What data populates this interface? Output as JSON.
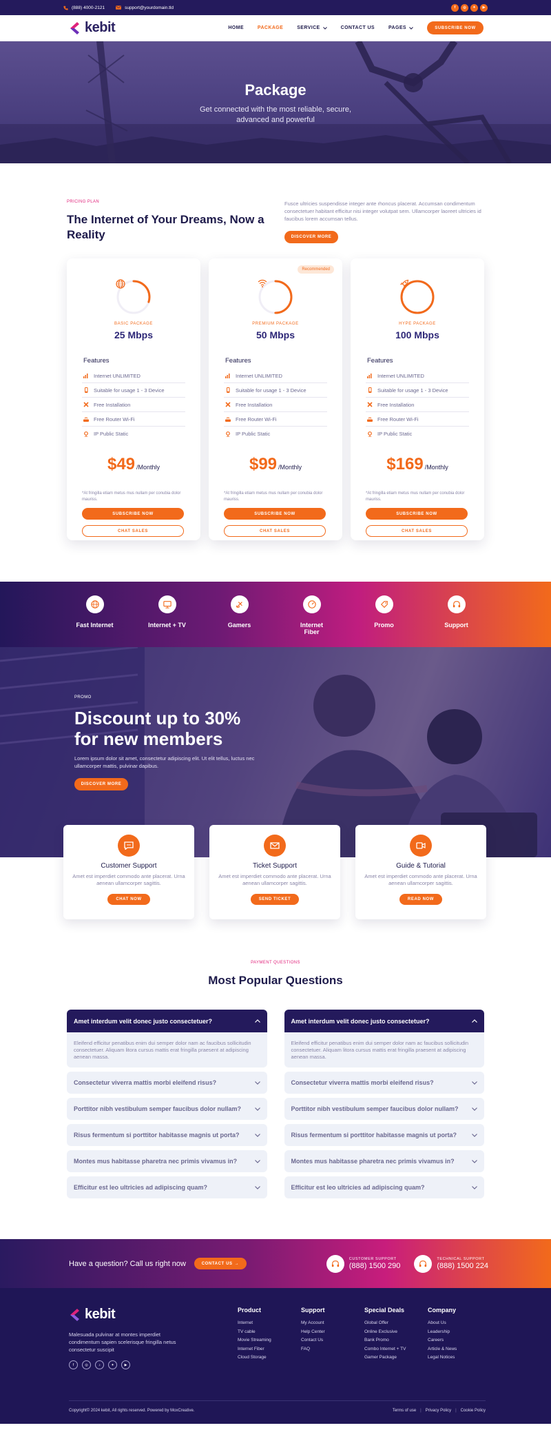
{
  "topbar": {
    "phone": "(888) 4000-2121",
    "email": "support@yourdomain.tld",
    "social": [
      "f",
      "ig",
      "tw",
      "yt"
    ]
  },
  "nav": {
    "logo": "kebit",
    "items": [
      {
        "label": "HOME"
      },
      {
        "label": "PACKAGE"
      },
      {
        "label": "SERVICE"
      },
      {
        "label": "CONTACT US"
      },
      {
        "label": "PAGES"
      }
    ],
    "cta": "SUBSCRIBE NOW"
  },
  "hero": {
    "title": "Package",
    "subtitle": "Get connected with the most reliable, secure, advanced and powerful"
  },
  "pricing": {
    "eyebrow": "PRICING PLAN",
    "title": "The Internet of Your Dreams, Now a Reality",
    "desc": "Fusce ultricies suspendisse integer ante rhoncus placerat. Accumsan condimentum consectetuer habitant efficitur nisi integer volutpat sem. Ullamcorper laoreet ultricies id faucibus lorem accumsan tellus.",
    "cta": "DISCOVER MORE"
  },
  "plans": [
    {
      "label": "BASIC PACKAGE",
      "speed": "25 Mbps",
      "progress": 0.3,
      "features_title": "Features",
      "features": [
        "Internet UNLIMITED",
        "Suitable for usage 1 - 3 Device",
        "Free Installation",
        "Free Router Wi-Fi",
        "IP Public Static"
      ],
      "price": "$49",
      "period": "/Monthly",
      "note": "*At fringilla etiam metus mus nullam per conubia dolor mauriss.",
      "subscribe": "SUBSCRIBE NOW",
      "chat": "CHAT SALES"
    },
    {
      "label": "PREMIUM PACKAGE",
      "speed": "50 Mbps",
      "progress": 0.5,
      "badge": "Recommended",
      "features_title": "Features",
      "features": [
        "Internet UNLIMITED",
        "Suitable for usage 1 - 3 Device",
        "Free Installation",
        "Free Router Wi-Fi",
        "IP Public Static"
      ],
      "price": "$99",
      "period": "/Monthly",
      "note": "*At fringilla etiam metus mus nullam per conubia dolor mauriss.",
      "subscribe": "SUBSCRIBE NOW",
      "chat": "CHAT SALES"
    },
    {
      "label": "HYPE PACKAGE",
      "speed": "100 Mbps",
      "progress": 1.0,
      "features_title": "Features",
      "features": [
        "Internet UNLIMITED",
        "Suitable for usage 1 - 3 Device",
        "Free Installation",
        "Free Router Wi-Fi",
        "IP Public Static"
      ],
      "price": "$169",
      "period": "/Monthly",
      "note": "*At fringilla etiam metus mus nullam per conubia dolor mauriss.",
      "subscribe": "SUBSCRIBE NOW",
      "chat": "CHAT SALES"
    }
  ],
  "categories": [
    "Fast Internet",
    "Internet + TV",
    "Gamers",
    "Internet Fiber",
    "Promo",
    "Support"
  ],
  "promo": {
    "eyebrow": "PROMO",
    "title_line1": "Discount up to 30%",
    "title_line2": "for new members",
    "text": "Lorem ipsum dolor sit amet, consectetur adipiscing elit. Ut elit tellus, luctus nec ullamcorper mattis, pulvinar dapibus.",
    "cta": "DISCOVER MORE"
  },
  "support_cards": [
    {
      "title": "Customer Support",
      "text": "Amet est imperdiet commodo ante placerat. Urna aenean ullamcorper sagittis.",
      "cta": "CHAT NOW"
    },
    {
      "title": "Ticket Support",
      "text": "Amet est imperdiet commodo ante placerat. Urna aenean ullamcorper sagittis.",
      "cta": "SEND TICKET"
    },
    {
      "title": "Guide & Tutorial",
      "text": "Amet est imperdiet commodo ante placerat. Urna aenean ullamcorper sagittis.",
      "cta": "READ NOW"
    }
  ],
  "faq": {
    "eyebrow": "PAYMENT QUESTIONS",
    "title": "Most Popular Questions",
    "columns": [
      {
        "open_q": "Amet interdum velit donec justo consectetuer?",
        "open_a": "Eleifend efficitur penatibus enim dui semper dolor nam ac faucibus sollicitudin consectetuer. Aliquam litora cursus mattis erat fringilla praesent at adipiscing aenean massa.",
        "items": [
          "Consectetur viverra mattis morbi eleifend risus?",
          "Porttitor nibh vestibulum semper faucibus dolor nullam?",
          "Risus fermentum si porttitor habitasse magnis ut porta?",
          "Montes mus habitasse pharetra nec primis vivamus in?",
          "Efficitur est leo ultricies ad adipiscing quam?"
        ]
      },
      {
        "open_q": "Amet interdum velit donec justo consectetuer?",
        "open_a": "Eleifend efficitur penatibus enim dui semper dolor nam ac faucibus sollicitudin consectetuer. Aliquam litora cursus mattis erat fringilla praesent at adipiscing aenean massa.",
        "items": [
          "Consectetur viverra mattis morbi eleifend risus?",
          "Porttitor nibh vestibulum semper faucibus dolor nullam?",
          "Risus fermentum si porttitor habitasse magnis ut porta?",
          "Montes mus habitasse pharetra nec primis vivamus in?",
          "Efficitur est leo ultricies ad adipiscing quam?"
        ]
      }
    ]
  },
  "cta": {
    "text": "Have a question? Call us right now",
    "button": "CONTACT US",
    "customer_label": "CUSTOMER SUPPORT",
    "customer_phone": "(888) 1500 290",
    "tech_label": "TECHNICAL SUPPORT",
    "tech_phone": "(888) 1500 224"
  },
  "footer": {
    "logo": "kebit",
    "about": "Malesuada pulvinar at montes imperdiet condimentum sapien scelerisque fringilla netus consectetur suscipit",
    "cols": [
      {
        "title": "Product",
        "links": [
          "Internet",
          "TV cable",
          "Movie Streaming",
          "Internet Fiber",
          "Cloud Storage"
        ]
      },
      {
        "title": "Support",
        "links": [
          "My Account",
          "Help Center",
          "Contact Us",
          "FAQ"
        ]
      },
      {
        "title": "Special Deals",
        "links": [
          "Global Offer",
          "Online Exclusive",
          "Bank Promo",
          "Combo Internet + TV",
          "Gamer Package"
        ]
      },
      {
        "title": "Company",
        "links": [
          "About Us",
          "Leadership",
          "Careers",
          "Article & News",
          "Legal Notices"
        ]
      }
    ],
    "copyright": "Copyright© 2024 kebit, All rights reserved. Powered by MoxCreative.",
    "legal": [
      "Terms of use",
      "Privacy Policy",
      "Cookie Policy"
    ]
  },
  "colors": {
    "accent": "#f26a1b",
    "navy": "#241a5c",
    "magenta": "#e0237b"
  }
}
